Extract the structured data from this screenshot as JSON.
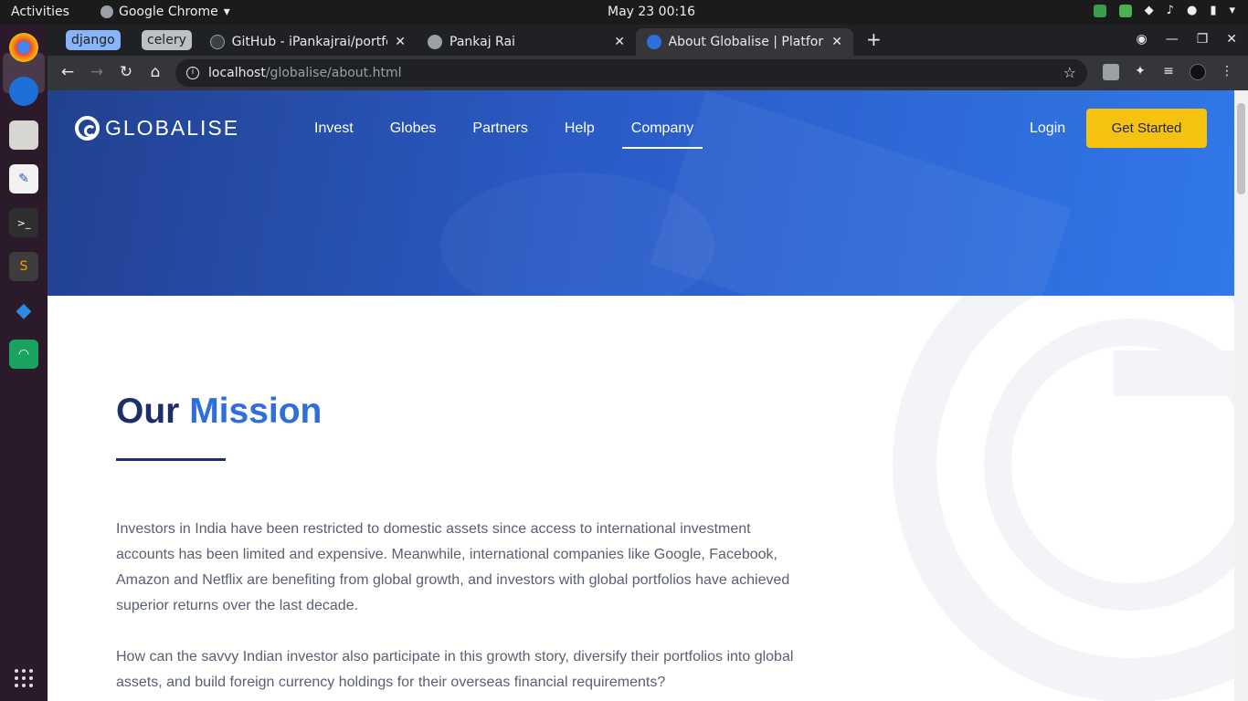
{
  "system": {
    "activities": "Activities",
    "app_name": "Google Chrome",
    "clock": "May 23  00:16"
  },
  "browser": {
    "tab_groups": [
      {
        "label": "django"
      },
      {
        "label": "celery"
      }
    ],
    "tabs": [
      {
        "title": "GitHub - iPankajrai/portfo",
        "close": "✕"
      },
      {
        "title": "Pankaj Rai",
        "close": "✕"
      },
      {
        "title": "About Globalise | Platform",
        "close": "✕"
      }
    ],
    "new_tab": "+",
    "url_host": "localhost",
    "url_path": "/globalise/about.html"
  },
  "site": {
    "logo_text": "GLOBALISE",
    "nav": [
      "Invest",
      "Globes",
      "Partners",
      "Help",
      "Company"
    ],
    "active_nav": "Company",
    "login": "Login",
    "cta": "Get Started",
    "mission_title_1": "Our",
    "mission_title_2": "Mission",
    "paragraph_1": "Investors in India have been restricted to domestic assets since access to international investment accounts has been limited and expensive. Meanwhile, international companies like Google, Facebook, Amazon and Netflix are benefiting from global growth, and investors with global portfolios have achieved superior returns over the last decade.",
    "paragraph_2": "How can the savvy Indian investor also participate in this growth story, diversify their portfolios into global assets, and build foreign currency holdings for their overseas financial requirements?"
  },
  "colors": {
    "brand_dark": "#1d2f6a",
    "brand_accent": "#2e6fd9",
    "cta_yellow": "#f5c211"
  }
}
